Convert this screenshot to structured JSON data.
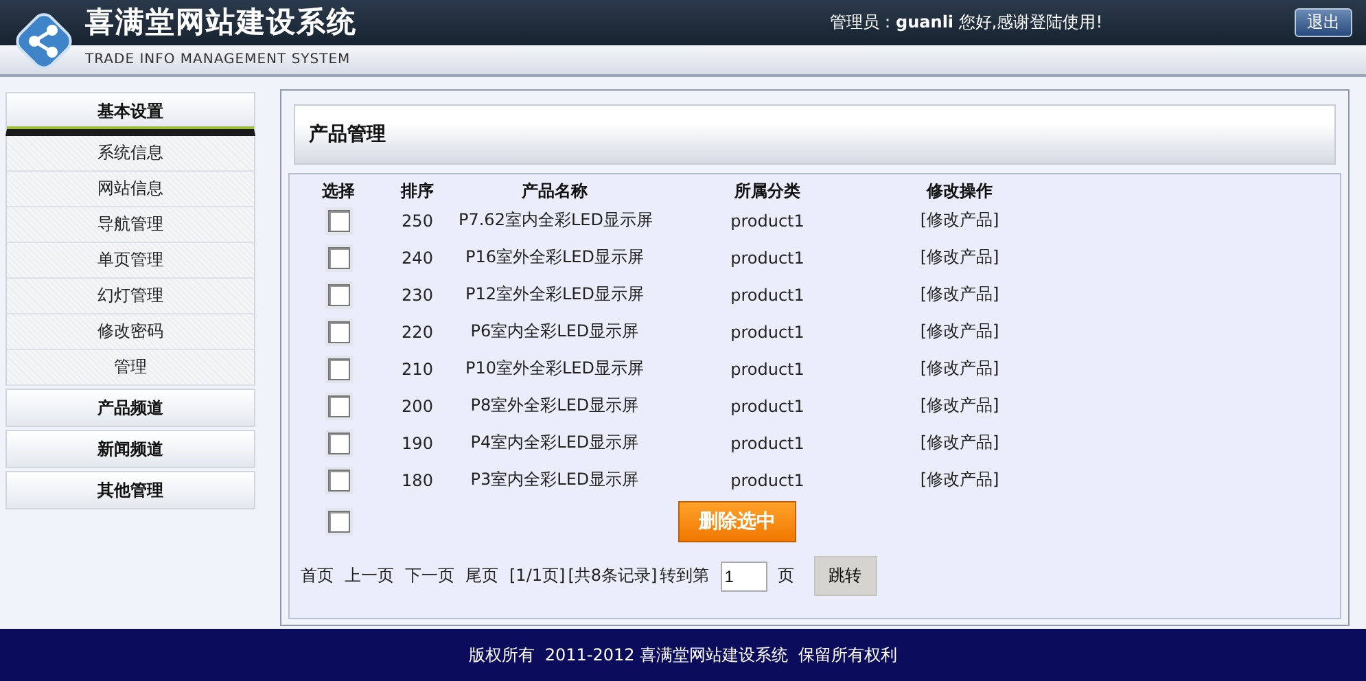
{
  "header": {
    "title": "喜满堂网站建设系统",
    "subtitle": "TRADE INFO MANAGEMENT SYSTEM",
    "greeting_label": "管理员：",
    "user": "guanli",
    "greeting_text": "您好,感谢登陆使用!",
    "logout": "退出"
  },
  "sidebar": {
    "groups": [
      {
        "title": "基本设置",
        "expanded": true,
        "items": [
          "系统信息",
          "网站信息",
          "导航管理",
          "单页管理",
          "幻灯管理",
          "修改密码",
          "管理"
        ]
      },
      {
        "title": "产品频道",
        "expanded": false
      },
      {
        "title": "新闻频道",
        "expanded": false
      },
      {
        "title": "其他管理",
        "expanded": false
      }
    ]
  },
  "panel": {
    "title": "产品管理"
  },
  "table": {
    "columns": [
      "选择",
      "排序",
      "产品名称",
      "所属分类",
      "修改操作"
    ],
    "rows": [
      {
        "checked": false,
        "order": "250",
        "name": "P7.62室内全彩LED显示屏",
        "category": "product1",
        "action": "[修改产品]"
      },
      {
        "checked": false,
        "order": "240",
        "name": "P16室外全彩LED显示屏",
        "category": "product1",
        "action": "[修改产品]"
      },
      {
        "checked": false,
        "order": "230",
        "name": "P12室外全彩LED显示屏",
        "category": "product1",
        "action": "[修改产品]"
      },
      {
        "checked": false,
        "order": "220",
        "name": "P6室内全彩LED显示屏",
        "category": "product1",
        "action": "[修改产品]"
      },
      {
        "checked": false,
        "order": "210",
        "name": "P10室外全彩LED显示屏",
        "category": "product1",
        "action": "[修改产品]"
      },
      {
        "checked": false,
        "order": "200",
        "name": "P8室外全彩LED显示屏",
        "category": "product1",
        "action": "[修改产品]"
      },
      {
        "checked": false,
        "order": "190",
        "name": "P4室内全彩LED显示屏",
        "category": "product1",
        "action": "[修改产品]"
      },
      {
        "checked": false,
        "order": "180",
        "name": "P3室内全彩LED显示屏",
        "category": "product1",
        "action": "[修改产品]"
      }
    ],
    "select_all_checked": false,
    "delete_button": "删除选中"
  },
  "pagination": {
    "links": [
      "首页",
      "上一页",
      "下一页",
      "尾页"
    ],
    "page_info": "[1/1页]",
    "record_info": "[共8条记录]",
    "goto_label": "转到第",
    "page_value": "1",
    "page_unit": "页",
    "jump_button": "跳转"
  },
  "footer": {
    "text": "版权所有  2011-2012 喜满堂网站建设系统  保留所有权利"
  }
}
